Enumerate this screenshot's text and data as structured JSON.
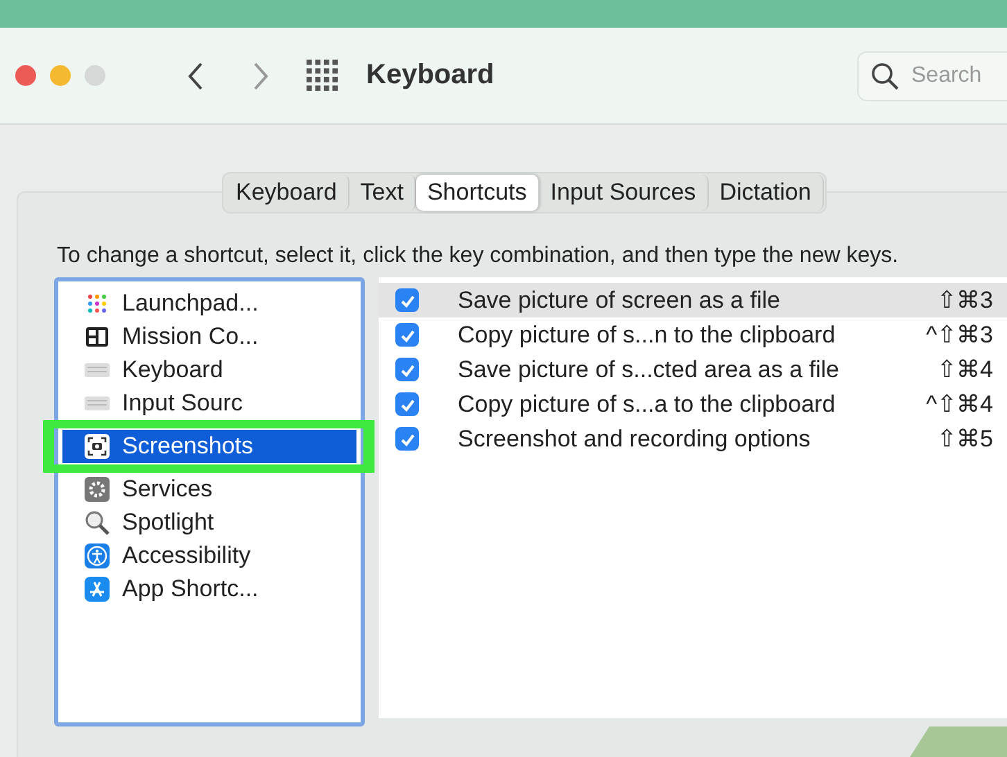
{
  "window": {
    "title": "Keyboard"
  },
  "search": {
    "placeholder": "Search"
  },
  "tabs": [
    {
      "label": "Keyboard",
      "selected": false
    },
    {
      "label": "Text",
      "selected": false
    },
    {
      "label": "Shortcuts",
      "selected": true
    },
    {
      "label": "Input Sources",
      "selected": false
    },
    {
      "label": "Dictation",
      "selected": false
    }
  ],
  "instruction": "To change a shortcut, select it, click the key combination, and then type the new keys.",
  "sidebar": {
    "items": [
      {
        "label": "Launchpad...",
        "kind": "launchpad",
        "selected": false,
        "highlighted": false
      },
      {
        "label": "Mission Co...",
        "kind": "mission",
        "selected": false,
        "highlighted": false
      },
      {
        "label": "Keyboard",
        "kind": "keyboard",
        "selected": false,
        "highlighted": false
      },
      {
        "label": "Input Sourc",
        "kind": "keyboard",
        "selected": false,
        "highlighted": false
      },
      {
        "label": "Screenshots",
        "kind": "screenshot",
        "selected": true,
        "highlighted": true
      },
      {
        "label": "Services",
        "kind": "gear",
        "selected": false,
        "highlighted": false
      },
      {
        "label": "Spotlight",
        "kind": "magnifier",
        "selected": false,
        "highlighted": false
      },
      {
        "label": "Accessibility",
        "kind": "accessibility",
        "selected": false,
        "highlighted": false
      },
      {
        "label": "App Shortc...",
        "kind": "appstore",
        "selected": false,
        "highlighted": false
      }
    ]
  },
  "shortcuts": [
    {
      "label": "Save picture of screen as a file",
      "keys": "⇧⌘3",
      "checked": true,
      "selected": true
    },
    {
      "label": "Copy picture of s...n to the clipboard",
      "keys": "^⇧⌘3",
      "checked": true,
      "selected": false
    },
    {
      "label": "Save picture of s...cted area as a file",
      "keys": "⇧⌘4",
      "checked": true,
      "selected": false
    },
    {
      "label": "Copy picture of s...a to the clipboard",
      "keys": "^⇧⌘4",
      "checked": true,
      "selected": false
    },
    {
      "label": "Screenshot and recording options",
      "keys": "⇧⌘5",
      "checked": true,
      "selected": false
    }
  ]
}
